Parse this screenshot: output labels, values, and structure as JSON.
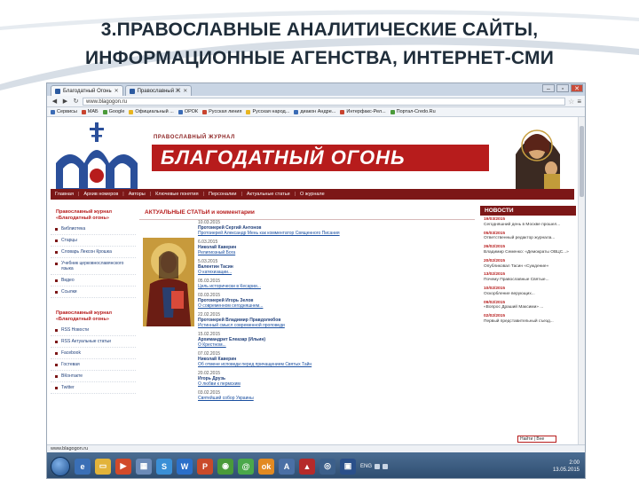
{
  "slide": {
    "title_line1": "3.ПРАВОСЛАВНЫЕ АНАЛИТИЧЕСКИЕ САЙТЫ,",
    "title_line2": "ИНФОРМАЦИОННЫЕ АГЕНСТВА, ИНТЕРНЕТ-СМИ"
  },
  "browser": {
    "tabs": [
      {
        "label": "Благодатный Огонь"
      },
      {
        "label": "Православный Ж"
      }
    ],
    "url": "www.blagogon.ru",
    "bookmarks": [
      "Сервисы",
      "МАБ",
      "Google",
      "Официальный ...",
      "ОРОК",
      "Русская линия",
      "Русская народ...",
      "диакон Андре...",
      "Интерфакс-Рел...",
      "Портал-Credo.Ru"
    ],
    "status": "www.blagogon.ru"
  },
  "site": {
    "journal_subtitle": "ПРАВОСЛАВНЫЙ ЖУРНАЛ",
    "journal_title": "БЛАГОДАТНЫЙ ОГОНЬ",
    "nav": [
      "Главная",
      "Архив номеров",
      "Авторы",
      "Ключевые понятия",
      "Персоналии",
      "Актуальные статьи",
      "О журнале"
    ],
    "left_head1": "Православный журнал «Благодатный огонь»",
    "left_items1": [
      "Библиотека",
      "Старцы",
      "Словарь Лексон Крошка",
      "Учебник церковнославянского языка",
      "Видео",
      "Ссылки"
    ],
    "left_head2": "Православный журнал «Благодатный огонь»",
    "left_items2": [
      "RSS Новости",
      "RSS Актуальные статьи",
      "Facebook",
      "Гостевая",
      "ВКонтакте",
      "Twitter"
    ],
    "main_head": "АКТУАЛЬНЫЕ СТАТЬИ и комментарии",
    "articles": [
      {
        "date": "10.03.2015",
        "author": "Протоиерей Сергий Антонов",
        "title": "Протоиерей Александр Мень как комментатор Священного Писания"
      },
      {
        "date": "6.03.2015",
        "author": "Николай Каверин",
        "title": "Религиозный Бога"
      },
      {
        "date": "5.03.2015",
        "author": "Валентин Тасин",
        "title": "О катехизации..."
      },
      {
        "date": "05.03.2015",
        "author": "",
        "title": "Цель исторически в Кесарии..."
      },
      {
        "date": "03.03.2015",
        "author": "Протоиерей Игорь Зелов",
        "title": "О современном сегодняшнем..."
      },
      {
        "date": "22.02.2015",
        "author": "Протоиерей Владимир Правдолюбов",
        "title": "Истинный смысл современной проповеди"
      },
      {
        "date": "15.02.2015",
        "author": "Архимандрит Елеазар (Ильин)",
        "title": "О Крестном..."
      },
      {
        "date": "07.02.2015",
        "author": "Николай Каверин",
        "title": "Об отмене исповеди перед причащением Святых Тайн"
      },
      {
        "date": "20.02.2015",
        "author": "Игорь Друзь",
        "title": "О любви к пермским"
      },
      {
        "date": "03.02.2015",
        "author": "",
        "title": "Святейший собор Украины"
      }
    ],
    "news_head": "НОВОСТИ",
    "news": [
      {
        "date": "19/03/2015",
        "text": "Сегодняшний день в Москве прошел..."
      },
      {
        "date": "05/03/2015",
        "text": "Ответственный редактор журнала..."
      },
      {
        "date": "26/02/2015",
        "text": "Владимир Семенко: «Демократы ОВЦС...»"
      },
      {
        "date": "20/02/2015",
        "text": "Опубликовал Тасин «Суждение»"
      },
      {
        "date": "13/02/2015",
        "text": "Почему Православные Святые..."
      },
      {
        "date": "10/02/2015",
        "text": "Оскорбление верующих..."
      },
      {
        "date": "09/02/2015",
        "text": "«Вопрос Драший Максими» ..."
      },
      {
        "date": "02/02/2015",
        "text": "Первый представительный съезд..."
      }
    ],
    "search_placeholder": "Найти",
    "search_button": "Вне"
  },
  "taskbar": {
    "lang": "ENG",
    "time": "2:00",
    "date": "13.05.2015"
  },
  "colors": {
    "site_red": "#b71c1c",
    "site_dark_red": "#7c1717",
    "taskbar": "#2d4b6e"
  }
}
